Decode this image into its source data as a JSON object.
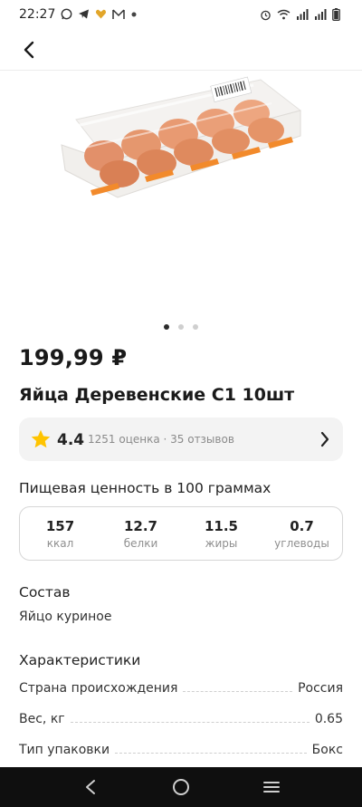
{
  "status_bar": {
    "time": "22:27",
    "left_icons": [
      "whatsapp-icon",
      "telegram-icon",
      "heart-icon",
      "mail-icon",
      "dot-icon"
    ],
    "right_icons": [
      "alarm-icon",
      "wifi-icon",
      "signal-icon",
      "signal-icon",
      "battery-icon"
    ]
  },
  "header": {
    "back_icon": "arrow-left-icon"
  },
  "gallery": {
    "image_alt": "egg carton",
    "dots_count": 3,
    "active_dot": 0
  },
  "product": {
    "price": "199,99 ₽",
    "title": "Яйца Деревенские С1 10шт"
  },
  "rating": {
    "value": "4.4",
    "meta": "1251 оценка · 35 отзывов",
    "star_color": "#ffc400"
  },
  "nutrition": {
    "title": "Пищевая ценность в 100 граммах",
    "items": [
      {
        "value": "157",
        "label": "ккал"
      },
      {
        "value": "12.7",
        "label": "белки"
      },
      {
        "value": "11.5",
        "label": "жиры"
      },
      {
        "value": "0.7",
        "label": "углеводы"
      }
    ]
  },
  "composition": {
    "title": "Состав",
    "text": "Яйцо куриное"
  },
  "characteristics": {
    "title": "Характеристики",
    "rows": [
      {
        "key": "Страна происхождения",
        "value": "Россия"
      },
      {
        "key": "Вес, кг",
        "value": "0.65"
      },
      {
        "key": "Тип упаковки",
        "value": "Бокс"
      }
    ]
  },
  "nav": {
    "back": "back-triangle-icon",
    "home": "home-circle-icon",
    "recents": "menu-lines-icon"
  }
}
